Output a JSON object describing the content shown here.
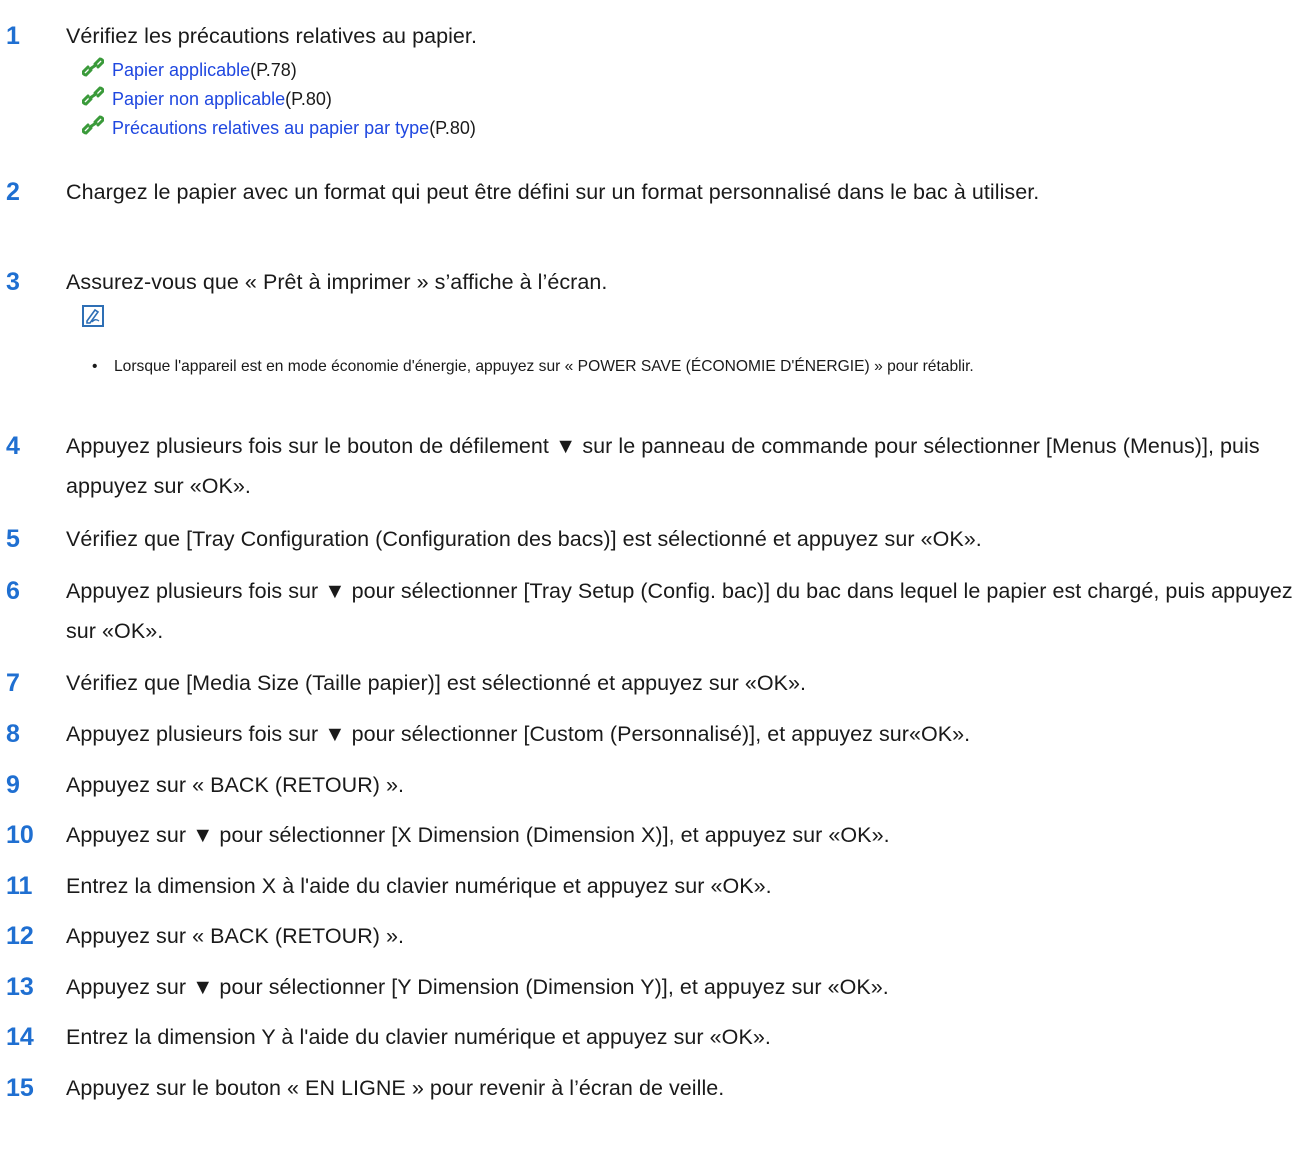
{
  "steps": [
    {
      "num": "1",
      "text": "Vérifiez les précautions relatives au papier."
    },
    {
      "num": "2",
      "text": "Chargez le papier avec un format qui peut être défini sur un format personnalisé dans le bac à utiliser."
    },
    {
      "num": "3",
      "text": "Assurez-vous que « Prêt à imprimer » s’affiche à l’écran."
    },
    {
      "num": "4",
      "text": "Appuyez plusieurs fois sur le bouton de défilement ▼ sur le panneau de commande pour sélectionner [Menus (Menus)], puis appuyez sur «OK»."
    },
    {
      "num": "5",
      "text": "Vérifiez que [Tray Configuration (Configuration des bacs)] est sélectionné et appuyez sur «OK»."
    },
    {
      "num": "6",
      "text": "Appuyez plusieurs fois sur ▼ pour sélectionner [Tray Setup (Config. bac)] du bac dans lequel le papier est chargé, puis appuyez sur «OK»."
    },
    {
      "num": "7",
      "text": "Vérifiez que [Media Size (Taille papier)] est sélectionné et appuyez sur «OK»."
    },
    {
      "num": "8",
      "text": "Appuyez plusieurs fois sur ▼ pour sélectionner [Custom (Personnalisé)], et appuyez sur«OK»."
    },
    {
      "num": "9",
      "text": "Appuyez sur « BACK (RETOUR) »."
    },
    {
      "num": "10",
      "text": "Appuyez sur ▼ pour sélectionner [X Dimension (Dimension X)], et appuyez sur «OK»."
    },
    {
      "num": "11",
      "text": "Entrez la dimension X à l'aide du clavier numérique et appuyez sur «OK»."
    },
    {
      "num": "12",
      "text": "Appuyez sur « BACK (RETOUR) »."
    },
    {
      "num": "13",
      "text": "Appuyez sur ▼ pour sélectionner [Y Dimension (Dimension Y)], et appuyez sur «OK»."
    },
    {
      "num": "14",
      "text": "Entrez la dimension Y à l'aide du clavier numérique et appuyez sur «OK»."
    },
    {
      "num": "15",
      "text": "Appuyez sur le bouton « EN LIGNE » pour revenir à l’écran de veille."
    }
  ],
  "links": [
    {
      "text": "Papier applicable",
      "page": "(P.78)",
      "icon": "link-chain-icon"
    },
    {
      "text": "Papier non applicable",
      "page": "(P.80)",
      "icon": "link-chain-icon"
    },
    {
      "text": "Précautions relatives au papier par type",
      "page": "(P.80)",
      "icon": "link-chain-icon"
    }
  ],
  "memo": {
    "icon": "memo-pencil-icon",
    "bullet": "•",
    "text": "Lorsque l'appareil est en mode économie d'énergie, appuyez sur « POWER SAVE (ÉCONOMIE D'ÉNERGIE) » pour rétablir."
  },
  "colors": {
    "step_number": "#1f6fd1",
    "link": "#1f47e0",
    "chain_icon": "#3a9a3a",
    "memo_icon": "#2e6fb5"
  }
}
